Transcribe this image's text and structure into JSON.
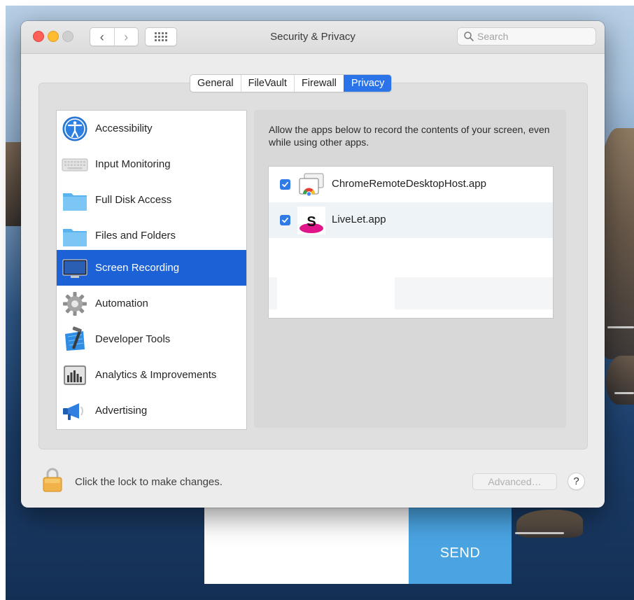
{
  "window": {
    "title": "Security & Privacy",
    "nav_back": "‹",
    "nav_forward": "›",
    "search_placeholder": "Search"
  },
  "tabs": [
    {
      "label": "General",
      "active": false
    },
    {
      "label": "FileVault",
      "active": false
    },
    {
      "label": "Firewall",
      "active": false
    },
    {
      "label": "Privacy",
      "active": true
    }
  ],
  "categories": [
    {
      "label": "Accessibility",
      "icon": "accessibility-icon",
      "selected": false
    },
    {
      "label": "Input Monitoring",
      "icon": "keyboard-icon",
      "selected": false
    },
    {
      "label": "Full Disk Access",
      "icon": "folder-icon",
      "selected": false
    },
    {
      "label": "Files and Folders",
      "icon": "folder-icon",
      "selected": false
    },
    {
      "label": "Screen Recording",
      "icon": "display-icon",
      "selected": true
    },
    {
      "label": "Automation",
      "icon": "gear-icon",
      "selected": false
    },
    {
      "label": "Developer Tools",
      "icon": "xcode-hammer-icon",
      "selected": false
    },
    {
      "label": "Analytics & Improvements",
      "icon": "bar-chart-icon",
      "selected": false
    },
    {
      "label": "Advertising",
      "icon": "megaphone-icon",
      "selected": false
    }
  ],
  "screen_recording": {
    "description": "Allow the apps below to record the contents of your screen, even while using other apps.",
    "apps": [
      {
        "label": "ChromeRemoteDesktopHost.app",
        "checked": true,
        "icon": "chrome-remote-desktop-icon"
      },
      {
        "label": "LiveLet.app",
        "checked": true,
        "icon": "livelet-app-icon"
      }
    ]
  },
  "footer": {
    "lock_text": "Click the lock to make changes.",
    "advanced_label": "Advanced…",
    "help_label": "?"
  },
  "web_form": {
    "send_label": "SEND"
  },
  "colors": {
    "accent": "#2a73e8",
    "selected_row": "#1c62d6",
    "send_button": "#4aa4e2",
    "close": "#fe5f57",
    "minimize": "#febc2e",
    "zoom": "#cfcfcf"
  }
}
